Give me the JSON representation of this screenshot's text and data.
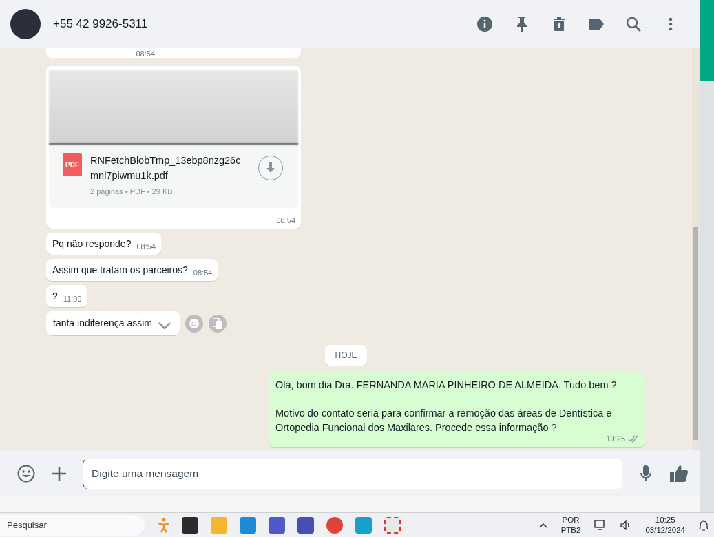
{
  "header": {
    "contact": "+55 42 9926-5311"
  },
  "messages": [
    {
      "kind": "fragment",
      "time": "08:54"
    },
    {
      "kind": "document",
      "file_name": "RNFetchBlobTmp_13ebp8nzg26cmnl7piwmu1k.pdf",
      "file_type": "PDF",
      "meta": "2 páginas • PDF • 29 KB",
      "time": "08:54"
    },
    {
      "kind": "text",
      "text": "Pq não responde?",
      "time": "08:54"
    },
    {
      "kind": "text",
      "text": "Assim que tratam os parceiros?",
      "time": "08:54"
    },
    {
      "kind": "text",
      "text": "?",
      "time": "11:09"
    },
    {
      "kind": "hovered",
      "text": "tanta indiferença assim"
    },
    {
      "kind": "date",
      "text": "HOJE"
    },
    {
      "kind": "outgoing",
      "text": "Olá, bom dia Dra. FERNANDA MARIA PINHEIRO DE ALMEIDA. Tudo bem ?\n\nMotivo do contato seria para confirmar a remoção das áreas de Dentística e Ortopedia Funcional dos Maxilares. Procede essa informação ?",
      "time": "10:25",
      "read": true
    }
  ],
  "composer": {
    "placeholder": "Digite uma mensagem"
  },
  "taskbar": {
    "search_placeholder": "Pesquisar",
    "language": "POR",
    "layout": "PTB2",
    "time": "10:25",
    "date": "03/12/2024"
  }
}
